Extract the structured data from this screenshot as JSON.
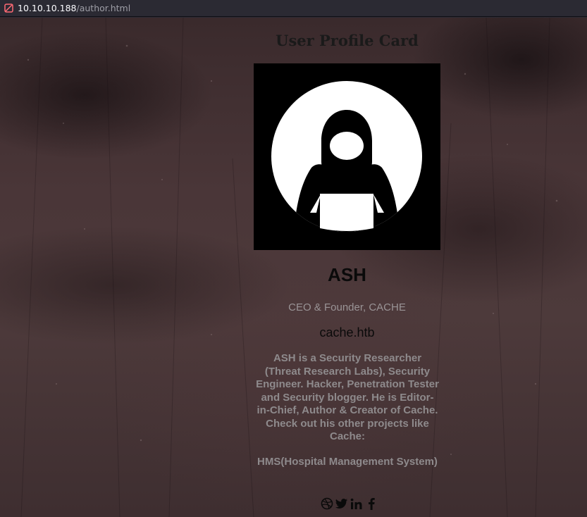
{
  "browser": {
    "url_host": "10.10.10.188",
    "url_path": "/author.html",
    "site_icon": "site-identity-icon"
  },
  "card": {
    "heading": "User Profile Card",
    "avatar_icon": "hooded-hacker-avatar-icon",
    "name": "ASH",
    "title": "CEO & Founder, CACHE",
    "domain": "cache.htb",
    "bio": "ASH is a Security Researcher (Threat Research Labs), Security Engineer. Hacker, Penetration Tester and Security blogger. He is Editor-in-Chief, Author & Creator of Cache. Check out his other projects like Cache:",
    "projects": "HMS(Hospital Management System)"
  },
  "social": [
    {
      "icon": "dribbble-icon"
    },
    {
      "icon": "twitter-icon"
    },
    {
      "icon": "linkedin-icon"
    },
    {
      "icon": "facebook-icon"
    }
  ],
  "colors": {
    "background": "#4a3638",
    "name_text": "#0a0a0a",
    "muted_text": "#8e8a8c",
    "avatar_bg": "#000000"
  }
}
